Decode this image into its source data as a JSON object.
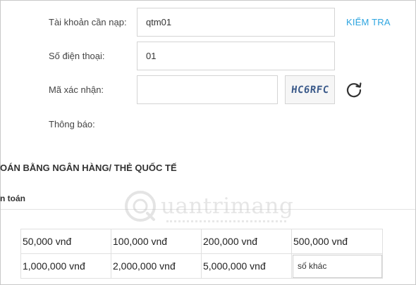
{
  "form": {
    "account_label": "Tài khoản cần nạp:",
    "account_value": "qtm01",
    "check_link": "KIỂM TRA",
    "phone_label": "Số điện thoại:",
    "phone_value": "01",
    "captcha_label": "Mã xác nhận:",
    "captcha_value": "",
    "captcha_code": "HC6RFC",
    "notice_label": "Thông báo:"
  },
  "section": {
    "bank_title": "OÁN BẰNG NGÂN HÀNG/ THẺ QUỐC TẾ",
    "sub_title": "n toán"
  },
  "watermark": "uantrimang",
  "amounts": {
    "row1": [
      "50,000 vnđ",
      "100,000 vnđ",
      "200,000 vnđ",
      "500,000 vnđ"
    ],
    "row2": [
      "1,000,000 vnđ",
      "2,000,000 vnđ",
      "5,000,000 vnđ"
    ],
    "other_placeholder": "số khác"
  },
  "colors": {
    "link": "#2ea5e0",
    "border": "#d4d4d4"
  }
}
